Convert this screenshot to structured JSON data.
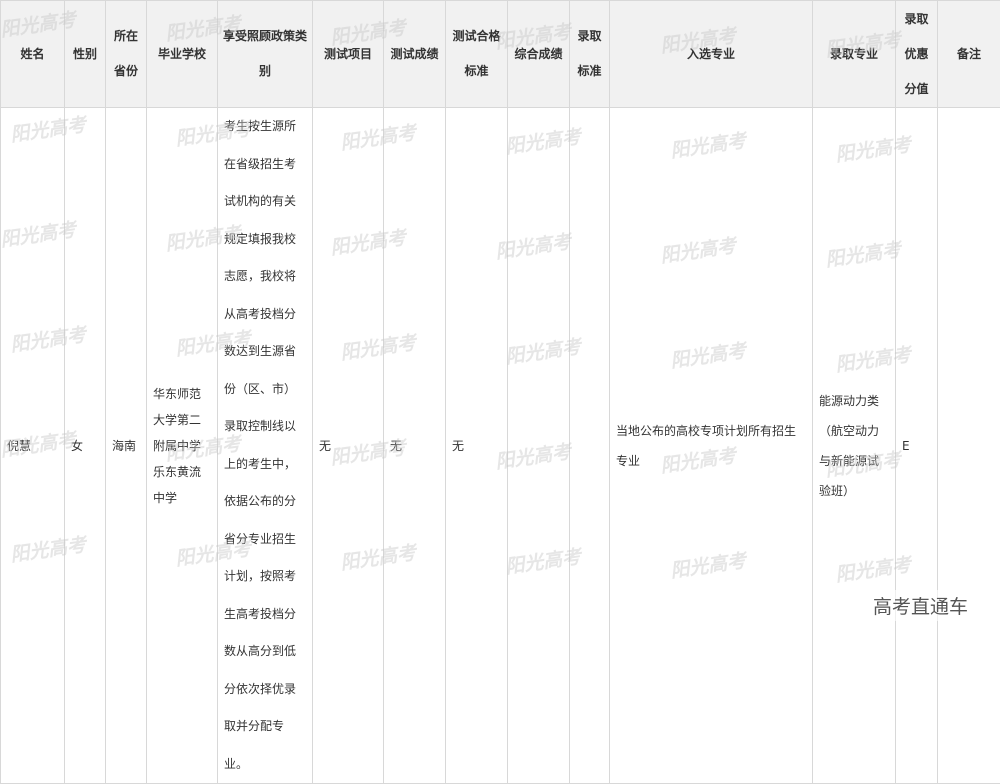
{
  "table": {
    "headers": {
      "name": "姓名",
      "gender": "性别",
      "province": "所在省份",
      "school": "毕业学校",
      "policy": "享受照顾政策类别",
      "test_item": "测试项目",
      "test_score": "测试成绩",
      "test_standard": "测试合格标准",
      "total_score": "综合成绩",
      "admit_standard": "录取标准",
      "selected_major": "入选专业",
      "admit_major": "录取专业",
      "bonus": "录取优惠分值",
      "remark": "备注"
    },
    "rows": [
      {
        "name": "倪慧",
        "gender": "女",
        "province": "海南",
        "school": "华东师范大学第二附属中学乐东黄流中学",
        "policy": "考生按生源所在省级招生考试机构的有关规定填报我校志愿，我校将从高考投档分数达到生源省份（区、市）录取控制线以上的考生中，依据公布的分省分专业招生计划，按照考生高考投档分数从高分到低分依次择优录取并分配专业。",
        "test_item": "无",
        "test_score": "无",
        "test_standard": "无",
        "total_score": "",
        "admit_standard": "",
        "selected_major": "当地公布的高校专项计划所有招生专业",
        "admit_major": "能源动力类（航空动力与新能源试验班）",
        "bonus": "E",
        "remark": ""
      }
    ]
  },
  "watermark_text": "阳光高考",
  "brand_text": "高考直通车"
}
